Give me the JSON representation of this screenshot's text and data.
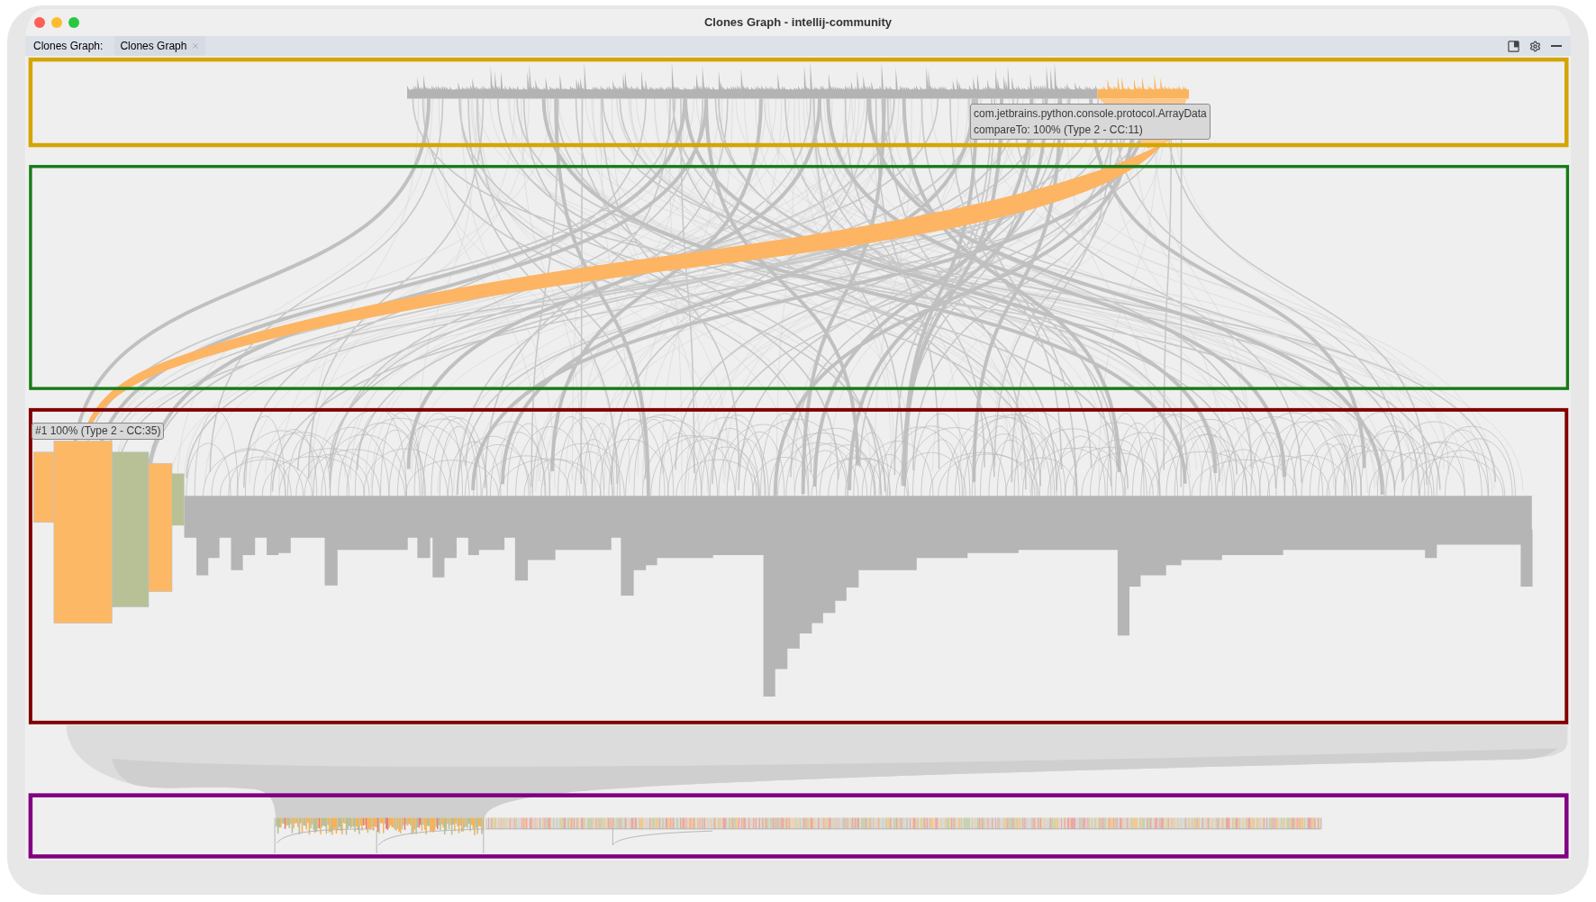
{
  "window": {
    "title": "Clones Graph - intellij-community"
  },
  "tool_window": {
    "label": "Clones Graph:",
    "tabs": [
      {
        "label": "Clones Graph",
        "selected": true,
        "closable": true
      }
    ]
  },
  "graph": {
    "highlight_frames": [
      {
        "color": "#d4a500"
      },
      {
        "color": "#167a16"
      },
      {
        "color": "#800000"
      },
      {
        "color": "#800080"
      }
    ],
    "tooltips": [
      {
        "lines": [
          "com.jetbrains.python.console.protocol.ArrayData",
          "compareTo: 100% (Type 2 - CC:11)"
        ]
      },
      {
        "lines": [
          "#1 100% (Type 2 - CC:35)"
        ]
      }
    ]
  }
}
